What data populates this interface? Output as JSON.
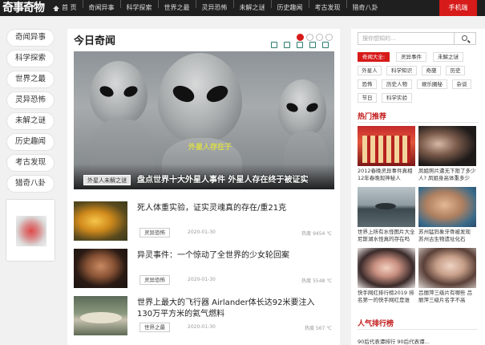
{
  "header": {
    "logo": "奇事奇物",
    "nav": [
      "首 页",
      "奇闻异事",
      "科学探索",
      "世界之最",
      "灵异恐怖",
      "未解之谜",
      "历史趣闻",
      "考古发现",
      "猎奇八卦"
    ],
    "mobile_label": "手机端"
  },
  "sidebar": {
    "items": [
      "奇闻异事",
      "科学探索",
      "世界之最",
      "灵异恐怖",
      "未解之谜",
      "历史趣闻",
      "考古发现",
      "猎奇八卦"
    ]
  },
  "main": {
    "title": "今日奇闻",
    "hero": {
      "badge": "外星人未解之谜",
      "title": "盘点世界十大外星人事件 外星人存在终于被证实",
      "watermark": "外星人存在于"
    },
    "articles": [
      {
        "title": "死人体重实验，证实灵魂真的存在/重21克",
        "tag": "灵异恐怖",
        "date": "2020-01-30",
        "heat": "热度 9454 ℃"
      },
      {
        "title": "异灵事件：一个惊动了全世界的少女轮回案",
        "tag": "灵异恐怖",
        "date": "2020-01-30",
        "heat": "热度 5548 ℃"
      },
      {
        "title": "世界上最大的飞行器 Airlander体长达92米要注入130万平方米的氦气燃料",
        "tag": "世界之最",
        "date": "2020-01-30",
        "heat": "热度 567 ℃"
      }
    ]
  },
  "right": {
    "search_placeholder": "搜你想知的...",
    "tags": [
      "奇闻大全:",
      "灵异事件",
      "未解之谜",
      "外星人",
      "科学知识",
      "奇葩",
      "历史",
      "恐怖",
      "历史人物",
      "娱乐圈秘",
      "杂谈",
      "节日",
      "科学实验"
    ],
    "hot_title": "热门推荐",
    "hot_items": [
      "2012春晚灵异事件真相 12年春晚现神秘人",
      "凤姐照片遭无下限了多少 人? 凤姐身高体重多少",
      "世界上所有水怪图片大全 尼斯湖水怪真的存在吗",
      "苏州猛犸象牙骨被发现 苏州古生物遗址化石",
      "快手网红排行榜2019 排名第一的快手网红是谁",
      "吕丽萍三级片有哪些 吕丽萍三级片名字不高"
    ],
    "rank_title": "人气排行榜",
    "rank_first": "90后代表谭排行 90后代表谭..."
  }
}
